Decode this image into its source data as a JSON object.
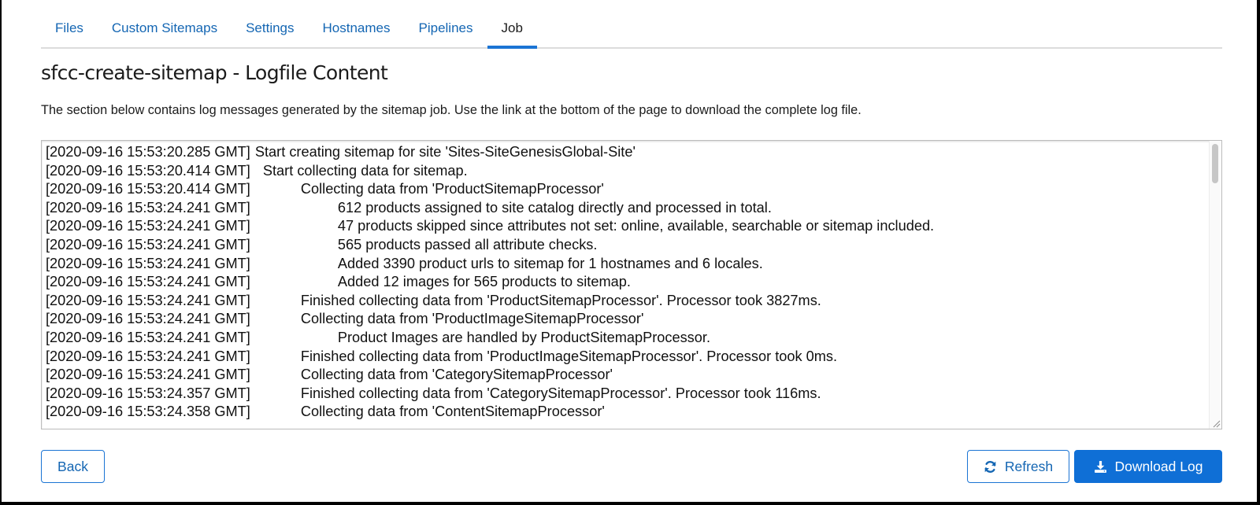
{
  "tabs": [
    {
      "label": "Files",
      "active": false
    },
    {
      "label": "Custom Sitemaps",
      "active": false
    },
    {
      "label": "Settings",
      "active": false
    },
    {
      "label": "Hostnames",
      "active": false
    },
    {
      "label": "Pipelines",
      "active": false
    },
    {
      "label": "Job",
      "active": true
    }
  ],
  "page": {
    "title": "sfcc-create-sitemap - Logfile Content",
    "description": "The section below contains log messages generated by the sitemap job. Use the link at the bottom of the page to download the complete log file."
  },
  "log": {
    "lines": [
      {
        "timestamp": "[2020-09-16 15:53:20.285 GMT]",
        "indent": 0,
        "message": "Start creating sitemap for site 'Sites-SiteGenesisGlobal-Site'"
      },
      {
        "timestamp": "[2020-09-16 15:53:20.414 GMT]",
        "indent": 1,
        "message": "Start collecting data for sitemap."
      },
      {
        "timestamp": "[2020-09-16 15:53:20.414 GMT]",
        "indent": 2,
        "message": "Collecting data from 'ProductSitemapProcessor'"
      },
      {
        "timestamp": "[2020-09-16 15:53:24.241 GMT]",
        "indent": 3,
        "message": "612 products assigned to site catalog directly and processed in total."
      },
      {
        "timestamp": "[2020-09-16 15:53:24.241 GMT]",
        "indent": 3,
        "message": "47 products skipped since attributes not set: online, available, searchable or sitemap included."
      },
      {
        "timestamp": "[2020-09-16 15:53:24.241 GMT]",
        "indent": 3,
        "message": "565 products passed all attribute checks."
      },
      {
        "timestamp": "[2020-09-16 15:53:24.241 GMT]",
        "indent": 3,
        "message": "Added 3390 product urls to sitemap for 1 hostnames and 6 locales."
      },
      {
        "timestamp": "[2020-09-16 15:53:24.241 GMT]",
        "indent": 3,
        "message": "Added 12 images for 565 products to sitemap."
      },
      {
        "timestamp": "[2020-09-16 15:53:24.241 GMT]",
        "indent": 2,
        "message": "Finished collecting data from 'ProductSitemapProcessor'. Processor took 3827ms."
      },
      {
        "timestamp": "[2020-09-16 15:53:24.241 GMT]",
        "indent": 2,
        "message": "Collecting data from 'ProductImageSitemapProcessor'"
      },
      {
        "timestamp": "[2020-09-16 15:53:24.241 GMT]",
        "indent": 3,
        "message": "Product Images are handled by ProductSitemapProcessor."
      },
      {
        "timestamp": "[2020-09-16 15:53:24.241 GMT]",
        "indent": 2,
        "message": "Finished collecting data from 'ProductImageSitemapProcessor'. Processor took 0ms."
      },
      {
        "timestamp": "[2020-09-16 15:53:24.241 GMT]",
        "indent": 2,
        "message": "Collecting data from 'CategorySitemapProcessor'"
      },
      {
        "timestamp": "[2020-09-16 15:53:24.357 GMT]",
        "indent": 2,
        "message": "Finished collecting data from 'CategorySitemapProcessor'. Processor took 116ms."
      },
      {
        "timestamp": "[2020-09-16 15:53:24.358 GMT]",
        "indent": 2,
        "message": "Collecting data from 'ContentSitemapProcessor'"
      }
    ]
  },
  "buttons": {
    "back": "Back",
    "refresh": "Refresh",
    "refresh_icon": "refresh-icon",
    "download": "Download Log",
    "download_icon": "download-icon"
  },
  "colors": {
    "accent": "#0f6fd6",
    "link": "#1466b3",
    "text": "#1b1b1b"
  }
}
